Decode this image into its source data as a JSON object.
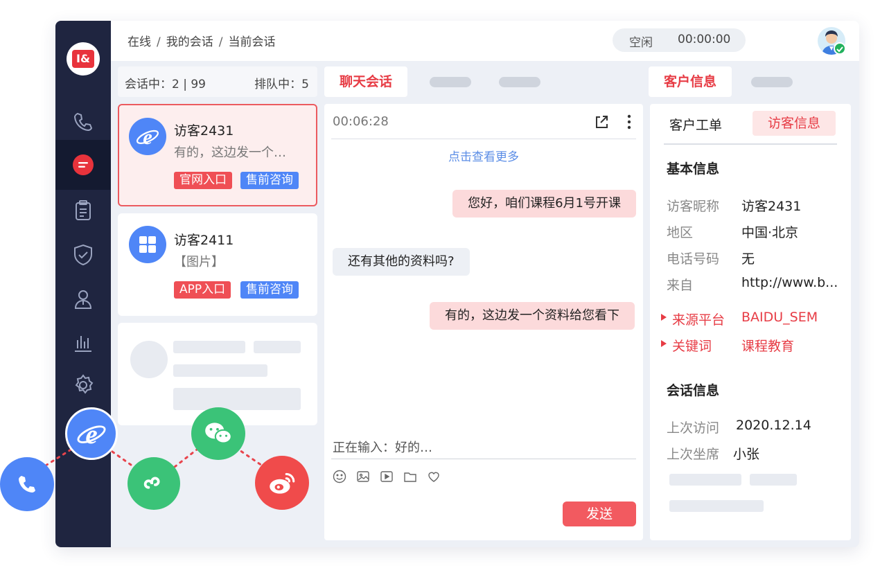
{
  "nav": {
    "logo_text": "I&",
    "items": [
      {
        "icon": "phone-icon"
      },
      {
        "icon": "chat-icon",
        "active": true
      },
      {
        "icon": "clipboard-icon"
      },
      {
        "icon": "shield-icon"
      },
      {
        "icon": "user-icon"
      },
      {
        "icon": "stats-icon"
      },
      {
        "icon": "gear-icon"
      }
    ]
  },
  "header": {
    "breadcrumb": [
      "在线",
      "我的会话",
      "当前会话"
    ],
    "status": "空闲",
    "timer": "00:00:00"
  },
  "sessions": {
    "in_session_label": "会话中：",
    "in_session_value": "2 | 99",
    "queue_label": "排队中：",
    "queue_value": "5",
    "items": [
      {
        "name": "访客2431",
        "preview": "有的，这边发一个…",
        "tags": [
          "官网入口",
          "售前咨询"
        ],
        "icon": "ie-icon"
      },
      {
        "name": "访客2411",
        "preview": "【图片】",
        "tags": [
          "APP入口",
          "售前咨询"
        ],
        "icon": "app-grid-icon"
      }
    ]
  },
  "chat": {
    "tab": "聊天会话",
    "timer": "00:06:28",
    "load_more": "点击查看更多",
    "messages": [
      {
        "from": "agent",
        "text": "您好，咱们课程6月1号开课"
      },
      {
        "from": "visitor",
        "text": "还有其他的资料吗?"
      },
      {
        "from": "agent",
        "text": "有的，这边发一个资料给您看下"
      }
    ],
    "typing": "正在输入：好的…",
    "send": "发送"
  },
  "customer": {
    "tab": "客户信息",
    "subtabs": [
      "客户工单",
      "访客信息"
    ],
    "basic_title": "基本信息",
    "basic": [
      {
        "label": "访客昵称",
        "value": "访客2431"
      },
      {
        "label": "地区",
        "value": "中国·北京"
      },
      {
        "label": "电话号码",
        "value": "无"
      },
      {
        "label": "来自",
        "value": "http://www.b..."
      }
    ],
    "highlight": [
      {
        "label": "来源平台",
        "value": "BAIDU_SEM"
      },
      {
        "label": "关键词",
        "value": "课程教育"
      }
    ],
    "session_title": "会话信息",
    "session": [
      {
        "label": "上次访问",
        "value": "2020.12.14"
      },
      {
        "label": "上次坐席",
        "value": "小张"
      }
    ]
  },
  "channels": [
    "phone-icon",
    "ie-icon",
    "mini-program-icon",
    "wechat-icon",
    "weibo-icon"
  ],
  "colors": {
    "accent": "#e73c45",
    "nav_bg": "#1f2540",
    "blue": "#4f86f7",
    "green": "#3bc378",
    "weibo": "#f04b4b"
  }
}
